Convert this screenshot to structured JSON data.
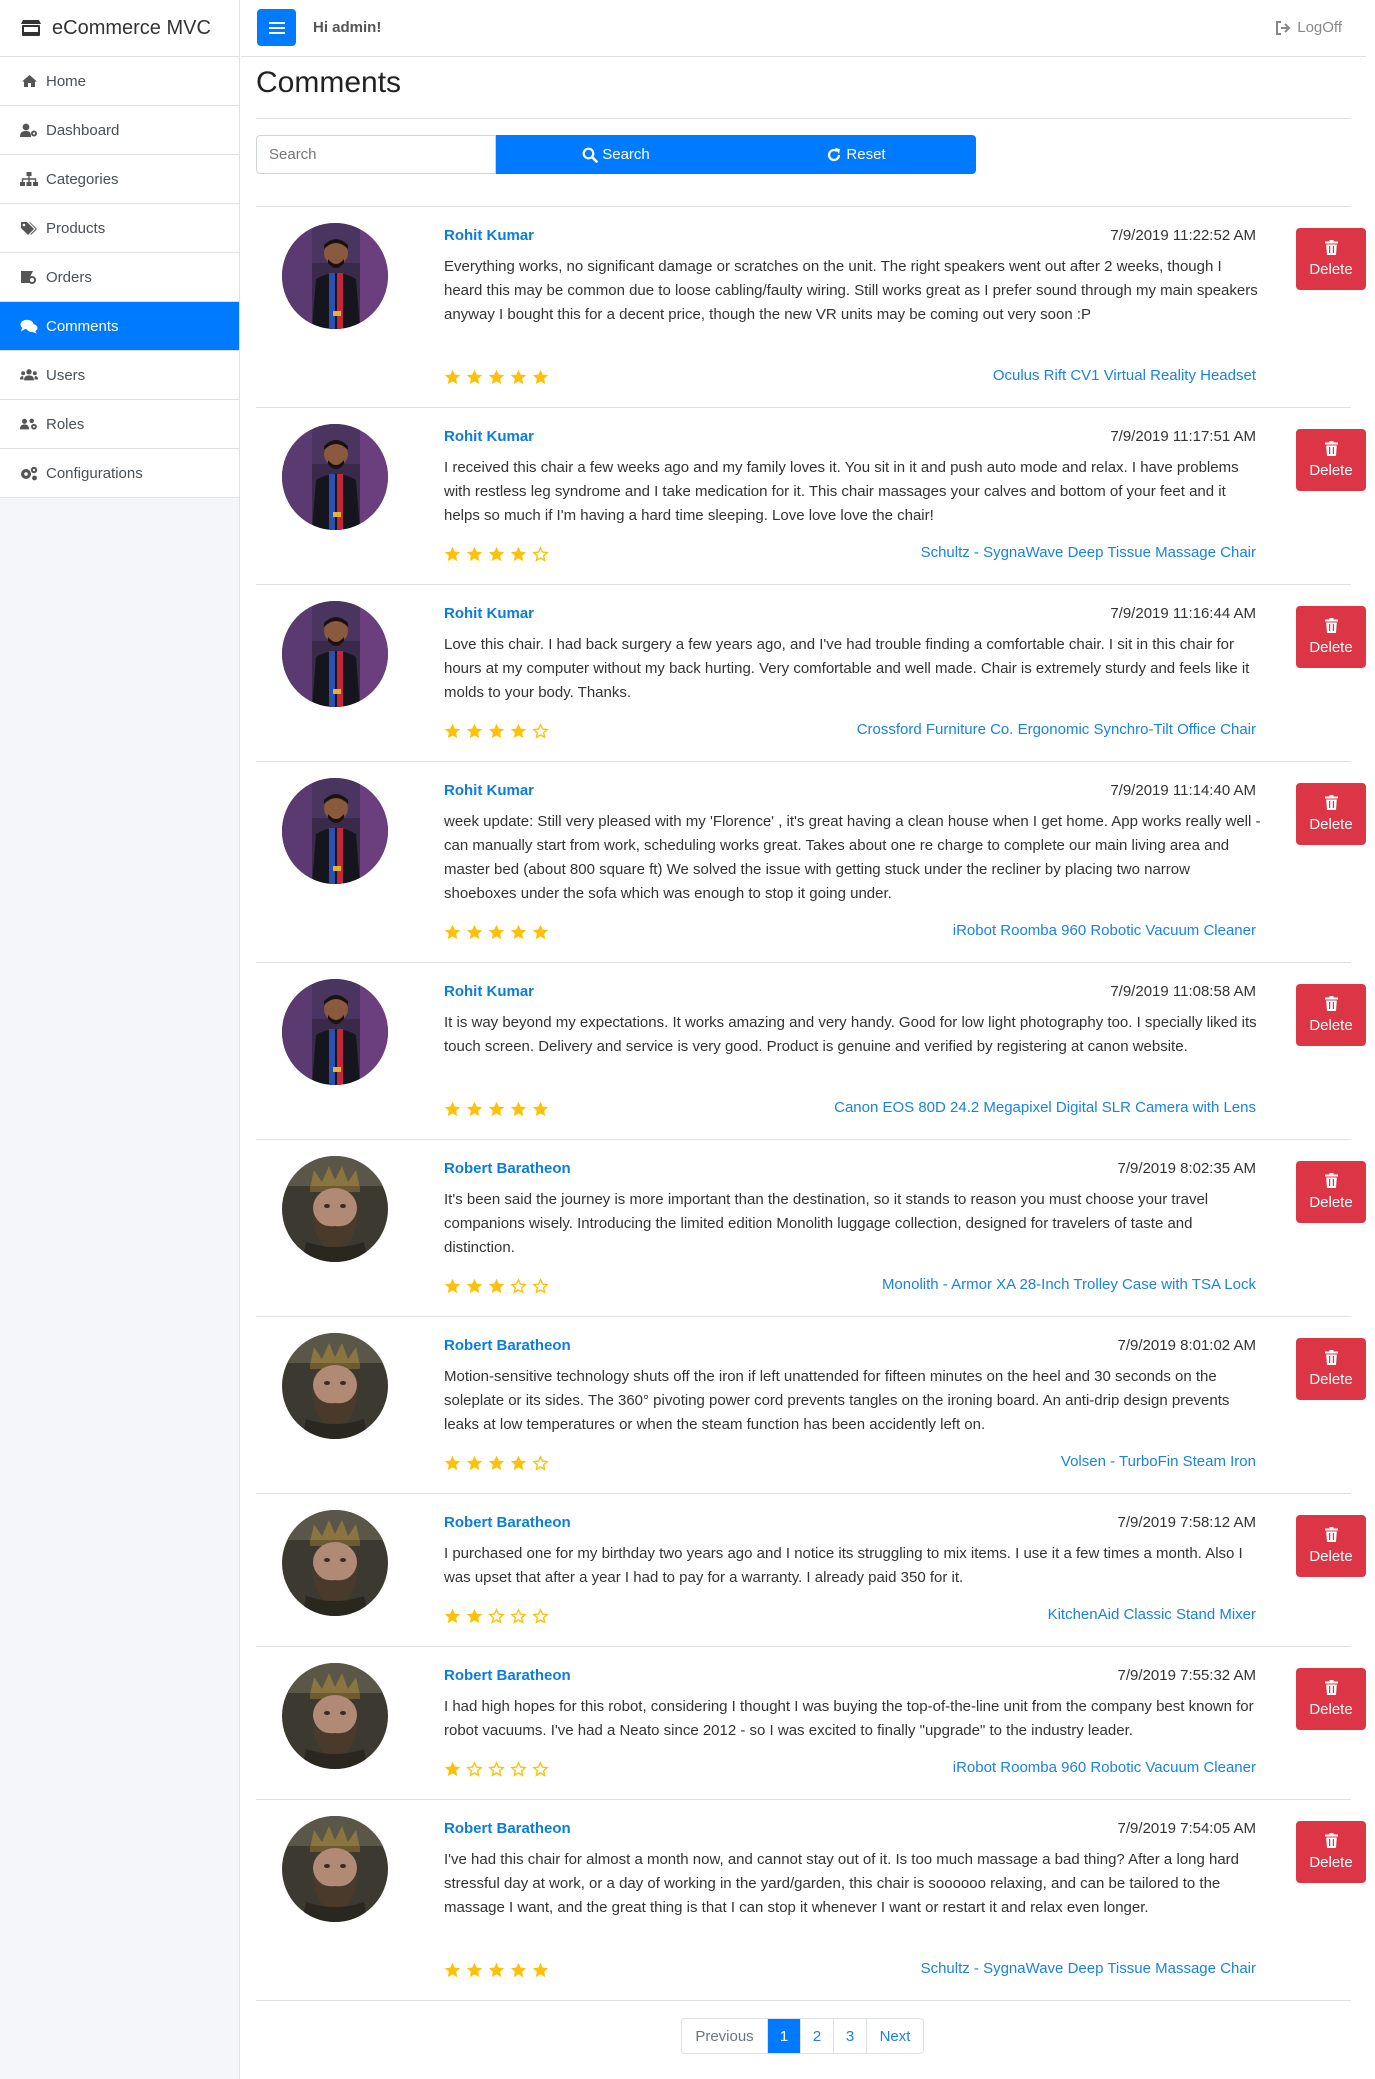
{
  "app": {
    "brand": "eCommerce MVC"
  },
  "header": {
    "greeting": "Hi admin!",
    "logoff": "LogOff"
  },
  "sidebar": {
    "items": [
      {
        "label": "Home",
        "icon": "home-icon"
      },
      {
        "label": "Dashboard",
        "icon": "user-cog-icon"
      },
      {
        "label": "Categories",
        "icon": "sitemap-icon"
      },
      {
        "label": "Products",
        "icon": "tags-icon"
      },
      {
        "label": "Orders",
        "icon": "orders-icon"
      },
      {
        "label": "Comments",
        "icon": "comments-icon",
        "active": true
      },
      {
        "label": "Users",
        "icon": "users-icon"
      },
      {
        "label": "Roles",
        "icon": "roles-icon"
      },
      {
        "label": "Configurations",
        "icon": "cogs-icon"
      }
    ]
  },
  "page": {
    "title": "Comments"
  },
  "search": {
    "placeholder": "Search",
    "search_label": "Search",
    "reset_label": "Reset"
  },
  "comments": [
    {
      "author": "Rohit Kumar",
      "date": "7/9/2019 11:22:52 AM",
      "text": "Everything works, no significant damage or scratches on the unit. The right speakers went out after 2 weeks, though I heard this may be common due to loose cabling/faulty wiring. Still works great as I prefer sound through my main speakers anyway I bought this for a decent price, though the new VR units may be coming out very soon :P",
      "rating": 5,
      "product": "Oculus Rift CV1 Virtual Reality Headset",
      "delete_label": "Delete"
    },
    {
      "author": "Rohit Kumar",
      "date": "7/9/2019 11:17:51 AM",
      "text": "I received this chair a few weeks ago and my family loves it. You sit in it and push auto mode and relax. I have problems with restless leg syndrome and I take medication for it. This chair massages your calves and bottom of your feet and it helps so much if I'm having a hard time sleeping. Love love love the chair!",
      "rating": 4,
      "product": "Schultz - SygnaWave Deep Tissue Massage Chair",
      "delete_label": "Delete"
    },
    {
      "author": "Rohit Kumar",
      "date": "7/9/2019 11:16:44 AM",
      "text": "Love this chair. I had back surgery a few years ago, and I've had trouble finding a comfortable chair. I sit in this chair for hours at my computer without my back hurting. Very comfortable and well made. Chair is extremely sturdy and feels like it molds to your body. Thanks.",
      "rating": 4,
      "product": "Crossford Furniture Co. Ergonomic Synchro-Tilt Office Chair",
      "delete_label": "Delete"
    },
    {
      "author": "Rohit Kumar",
      "date": "7/9/2019 11:14:40 AM",
      "text": "week update: Still very pleased with my 'Florence' , it's great having a clean house when I get home. App works really well - can manually start from work, scheduling works great. Takes about one re charge to complete our main living area and master bed (about 800 square ft) We solved the issue with getting stuck under the recliner by placing two narrow shoeboxes under the sofa which was enough to stop it going under.",
      "rating": 5,
      "product": "iRobot Roomba 960 Robotic Vacuum Cleaner",
      "delete_label": "Delete"
    },
    {
      "author": "Rohit Kumar",
      "date": "7/9/2019 11:08:58 AM",
      "text": "It is way beyond my expectations. It works amazing and very handy. Good for low light photography too. I specially liked its touch screen. Delivery and service is very good. Product is genuine and verified by registering at canon website.",
      "rating": 5,
      "product": "Canon EOS 80D 24.2 Megapixel Digital SLR Camera with Lens",
      "delete_label": "Delete"
    },
    {
      "author": "Robert Baratheon",
      "date": "7/9/2019 8:02:35 AM",
      "text": "It's been said the journey is more important than the destination, so it stands to reason you must choose your travel companions wisely. Introducing the limited edition Monolith luggage collection, designed for travelers of taste and distinction.",
      "rating": 3,
      "product": "Monolith - Armor XA 28-Inch Trolley Case with TSA Lock",
      "delete_label": "Delete"
    },
    {
      "author": "Robert Baratheon",
      "date": "7/9/2019 8:01:02 AM",
      "text": "Motion-sensitive technology shuts off the iron if left unattended for fifteen minutes on the heel and 30 seconds on the soleplate or its sides. The 360° pivoting power cord prevents tangles on the ironing board. An anti-drip design prevents leaks at low temperatures or when the steam function has been accidently left on.",
      "rating": 4,
      "product": "Volsen - TurboFin Steam Iron",
      "delete_label": "Delete"
    },
    {
      "author": "Robert Baratheon",
      "date": "7/9/2019 7:58:12 AM",
      "text": "I purchased one for my birthday two years ago and I notice its struggling to mix items. I use it a few times a month. Also I was upset that after a year I had to pay for a warranty. I already paid 350 for it.",
      "rating": 2,
      "product": "KitchenAid Classic Stand Mixer",
      "delete_label": "Delete"
    },
    {
      "author": "Robert Baratheon",
      "date": "7/9/2019 7:55:32 AM",
      "text": "I had high hopes for this robot, considering I thought I was buying the top-of-the-line unit from the company best known for robot vacuums. I've had a Neato since 2012 - so I was excited to finally \"upgrade\" to the industry leader.",
      "rating": 1,
      "product": "iRobot Roomba 960 Robotic Vacuum Cleaner",
      "delete_label": "Delete"
    },
    {
      "author": "Robert Baratheon",
      "date": "7/9/2019 7:54:05 AM",
      "text": "I've had this chair for almost a month now, and cannot stay out of it. Is too much massage a bad thing? After a long hard stressful day at work, or a day of working in the yard/garden, this chair is soooooo relaxing, and can be tailored to the massage I want, and the great thing is that I can stop it whenever I want or restart it and relax even longer.",
      "rating": 5,
      "product": "Schultz - SygnaWave Deep Tissue Massage Chair",
      "delete_label": "Delete"
    }
  ],
  "pagination": {
    "previous": "Previous",
    "pages": [
      "1",
      "2",
      "3"
    ],
    "current": "1",
    "next": "Next"
  },
  "colors": {
    "primary": "#007bff",
    "danger": "#dc3545",
    "star": "#ffc107",
    "link": "#1a82e2"
  }
}
